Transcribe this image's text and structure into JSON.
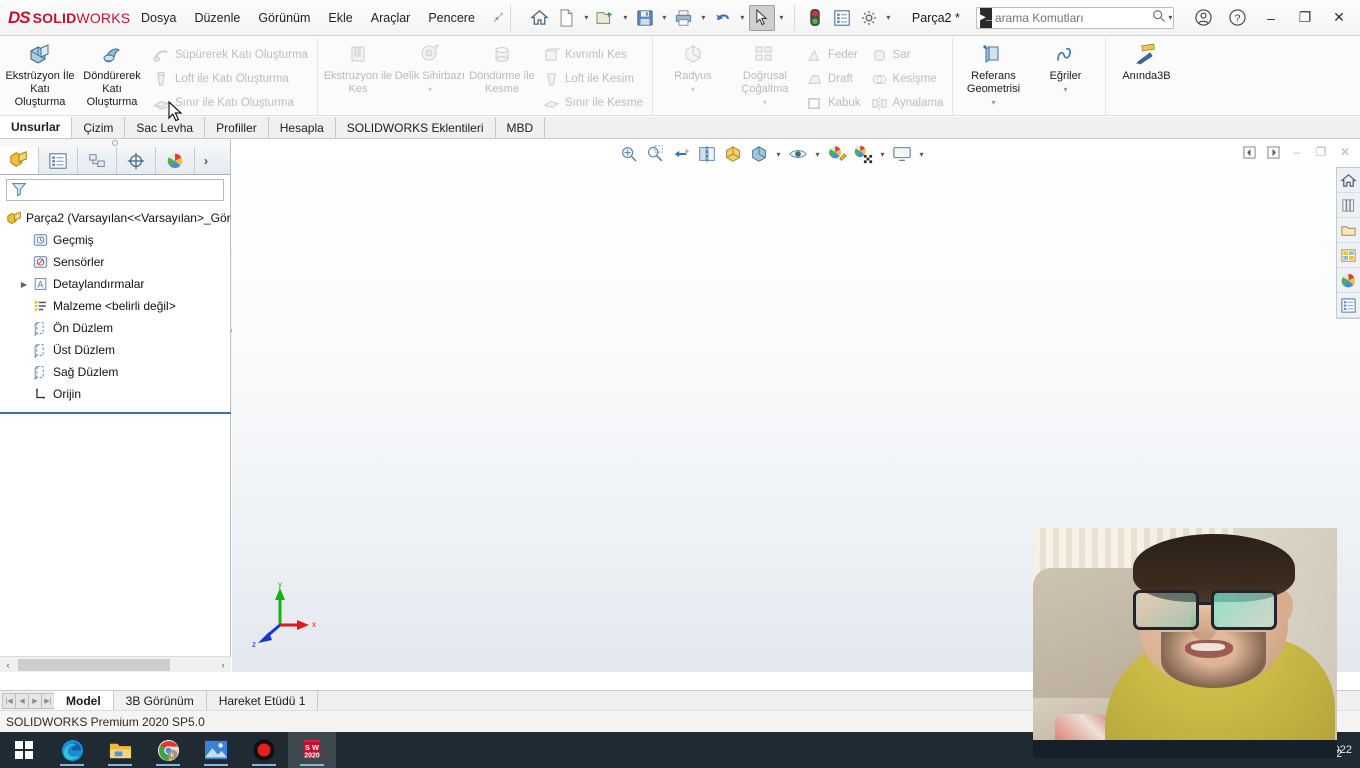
{
  "titlebar": {
    "logo_ds": "DS",
    "logo_solid": "SOLID",
    "logo_works": "WORKS",
    "menu": [
      {
        "label": "Dosya",
        "name": "menu-dosya"
      },
      {
        "label": "Düzenle",
        "name": "menu-duzenle"
      },
      {
        "label": "Görünüm",
        "name": "menu-gorunum"
      },
      {
        "label": "Ekle",
        "name": "menu-ekle"
      },
      {
        "label": "Araçlar",
        "name": "menu-araclar"
      },
      {
        "label": "Pencere",
        "name": "menu-pencere"
      }
    ],
    "pin_icon": "pin-icon",
    "document_title": "Parça2 *",
    "search_value": "arama Komutları",
    "search_placeholder": "arama Komutları",
    "quick_access": [
      {
        "name": "home-icon",
        "tip": "Home"
      },
      {
        "name": "new-document-icon",
        "tip": "Yeni"
      },
      {
        "name": "open-document-icon",
        "tip": "Aç"
      },
      {
        "name": "save-icon",
        "tip": "Kaydet"
      },
      {
        "name": "print-icon",
        "tip": "Yazdır"
      },
      {
        "name": "undo-icon",
        "tip": "Geri Al"
      },
      {
        "name": "select-cursor-icon",
        "tip": "Seç"
      },
      {
        "name": "rebuild-traffic-light-icon",
        "tip": "Yeniden Oluştur"
      },
      {
        "name": "properties-icon",
        "tip": "Özellikler"
      },
      {
        "name": "options-gear-icon",
        "tip": "Seçenekler"
      }
    ],
    "window_buttons": {
      "account": "account-icon",
      "help": "help-icon",
      "minimize": "–",
      "restore": "❐",
      "close": "✕"
    }
  },
  "ribbon": {
    "groups": [
      {
        "name": "boss-base-group",
        "big": [
          {
            "label": "Ekstrüzyon İle Katı Oluşturma",
            "icon": "extrude-boss-icon",
            "disabled": false
          },
          {
            "label": "Döndürerek Katı Oluşturma",
            "icon": "revolve-boss-icon",
            "disabled": false
          }
        ],
        "small": [
          {
            "label": "Süpürerek Katı Oluşturma",
            "icon": "sweep-boss-icon",
            "disabled": true
          },
          {
            "label": "Loft ile Katı Oluşturma",
            "icon": "loft-boss-icon",
            "disabled": true
          },
          {
            "label": "Sınır ile Katı Oluşturma",
            "icon": "boundary-boss-icon",
            "disabled": true
          }
        ]
      },
      {
        "name": "cut-group",
        "big": [
          {
            "label": "Ekstrüzyon ile Kes",
            "icon": "extrude-cut-icon",
            "disabled": true
          },
          {
            "label": "Delik Sihirbazı",
            "icon": "hole-wizard-icon",
            "disabled": true,
            "caret": true
          },
          {
            "label": "Döndürme ile Kesme",
            "icon": "revolve-cut-icon",
            "disabled": true
          }
        ],
        "small": [
          {
            "label": "Kıvrımlı Kes",
            "icon": "swept-cut-icon",
            "disabled": true
          },
          {
            "label": "Loft ile Kesim",
            "icon": "lofted-cut-icon",
            "disabled": true
          },
          {
            "label": "Sınır ile Kesme",
            "icon": "boundary-cut-icon",
            "disabled": true
          }
        ]
      },
      {
        "name": "feature-group",
        "big": [
          {
            "label": "Radyus",
            "icon": "fillet-icon",
            "disabled": true,
            "caret": true
          },
          {
            "label": "Doğrusal Çoğaltma",
            "icon": "linear-pattern-icon",
            "disabled": true,
            "caret": true
          }
        ],
        "small": [
          {
            "label": "Feder",
            "icon": "rib-icon",
            "disabled": true
          },
          {
            "label": "Draft",
            "icon": "draft-icon",
            "disabled": true
          },
          {
            "label": "Kabuk",
            "icon": "shell-icon",
            "disabled": true
          }
        ],
        "small2": [
          {
            "label": "Sar",
            "icon": "wrap-icon",
            "disabled": true
          },
          {
            "label": "Kesişme",
            "icon": "intersect-icon",
            "disabled": true
          },
          {
            "label": "Aynalama",
            "icon": "mirror-icon",
            "disabled": true
          }
        ]
      },
      {
        "name": "reference-group",
        "big": [
          {
            "label": "Referans Geometrisi",
            "icon": "reference-geometry-icon",
            "disabled": false,
            "caret": true
          },
          {
            "label": "Eğriler",
            "icon": "curves-icon",
            "disabled": false,
            "caret": true
          }
        ]
      },
      {
        "name": "instant3d-group",
        "big": [
          {
            "label": "Anında3B",
            "icon": "instant3d-icon",
            "disabled": false
          }
        ]
      }
    ],
    "tabs": [
      {
        "label": "Unsurlar",
        "active": true
      },
      {
        "label": "Çizim",
        "active": false
      },
      {
        "label": "Sac Levha",
        "active": false
      },
      {
        "label": "Profiller",
        "active": false
      },
      {
        "label": "Hesapla",
        "active": false
      },
      {
        "label": "SOLIDWORKS Eklentileri",
        "active": false
      },
      {
        "label": "MBD",
        "active": false
      }
    ]
  },
  "left_panel": {
    "tabs": [
      {
        "name": "feature-manager-tab",
        "icon": "feature-tree-icon",
        "active": true
      },
      {
        "name": "property-manager-tab",
        "icon": "property-manager-icon",
        "active": false
      },
      {
        "name": "configuration-manager-tab",
        "icon": "configuration-icon",
        "active": false
      },
      {
        "name": "dimxpert-manager-tab",
        "icon": "dimxpert-icon",
        "active": false
      },
      {
        "name": "display-manager-tab",
        "icon": "display-manager-icon",
        "active": false
      }
    ],
    "more_button": "›",
    "filter_icon": "filter-icon",
    "filter_value": "",
    "tree": [
      {
        "label": "Parça2  (Varsayılan<<Varsayılan>_Gör",
        "icon": "part-icon",
        "indent": 0,
        "expander": ""
      },
      {
        "label": "Geçmiş",
        "icon": "history-icon",
        "indent": 1,
        "expander": ""
      },
      {
        "label": "Sensörler",
        "icon": "sensors-icon",
        "indent": 1,
        "expander": ""
      },
      {
        "label": "Detaylandırmalar",
        "icon": "annotations-icon",
        "indent": 1,
        "expander": "▶"
      },
      {
        "label": "Malzeme <belirli değil>",
        "icon": "material-icon",
        "indent": 1,
        "expander": ""
      },
      {
        "label": "Ön Düzlem",
        "icon": "plane-icon",
        "indent": 1,
        "expander": ""
      },
      {
        "label": "Üst Düzlem",
        "icon": "plane-icon",
        "indent": 1,
        "expander": ""
      },
      {
        "label": "Sağ Düzlem",
        "icon": "plane-icon",
        "indent": 1,
        "expander": ""
      },
      {
        "label": "Orijin",
        "icon": "origin-icon",
        "indent": 1,
        "expander": ""
      }
    ],
    "scroll_left_arrow": "‹",
    "scroll_right_arrow": "›"
  },
  "graphics": {
    "view_toolbar": [
      {
        "name": "zoom-to-fit-icon"
      },
      {
        "name": "zoom-to-area-icon"
      },
      {
        "name": "previous-view-icon"
      },
      {
        "name": "section-view-icon"
      },
      {
        "name": "view-orientation-icon"
      },
      {
        "name": "display-style-icon",
        "caret": true
      },
      {
        "name": "hide-show-items-icon",
        "caret": true
      },
      {
        "name": "edit-appearance-icon",
        "caret": true
      },
      {
        "name": "apply-scene-icon",
        "caret": true
      },
      {
        "name": "view-settings-icon",
        "caret": true
      }
    ],
    "doc_window_buttons": [
      "⊣",
      "⊢",
      "–",
      "❐",
      "✕"
    ],
    "triad": {
      "x_label": "x",
      "y_label": "y",
      "z_label": "z",
      "x_color": "#e01b1b",
      "y_color": "#12b312",
      "z_color": "#1535d6"
    },
    "task_pane": [
      {
        "name": "task-pane-home-icon"
      },
      {
        "name": "design-library-icon"
      },
      {
        "name": "file-explorer-icon"
      },
      {
        "name": "view-palette-icon"
      },
      {
        "name": "appearances-scenes-icon"
      },
      {
        "name": "custom-properties-icon"
      }
    ]
  },
  "bottom": {
    "nav_buttons": [
      "|◀",
      "◀",
      "▶",
      "▶|"
    ],
    "tabs": [
      {
        "label": "Model",
        "active": true
      },
      {
        "label": "3B Görünüm",
        "active": false
      },
      {
        "label": "Hareket Etüdü 1",
        "active": false
      }
    ],
    "status_text": "SOLIDWORKS Premium 2020 SP5.0"
  },
  "taskbar": {
    "items": [
      {
        "name": "start-button-icon",
        "label": "Başlat"
      },
      {
        "name": "microsoft-edge-icon",
        "label": "Microsoft Edge"
      },
      {
        "name": "file-explorer-icon",
        "label": "Dosya Gezgini"
      },
      {
        "name": "google-chrome-icon",
        "label": "Google Chrome"
      },
      {
        "name": "photos-icon",
        "label": "Fotoğraflar"
      },
      {
        "name": "screen-recorder-icon",
        "label": "Kayıt"
      },
      {
        "name": "solidworks-2020-icon",
        "label": "SOLIDWORKS 2020"
      }
    ],
    "tray_date": "30.09.2022"
  },
  "webcam": {
    "name": "webcam-overlay",
    "description": "Kamera görüntüsü"
  }
}
